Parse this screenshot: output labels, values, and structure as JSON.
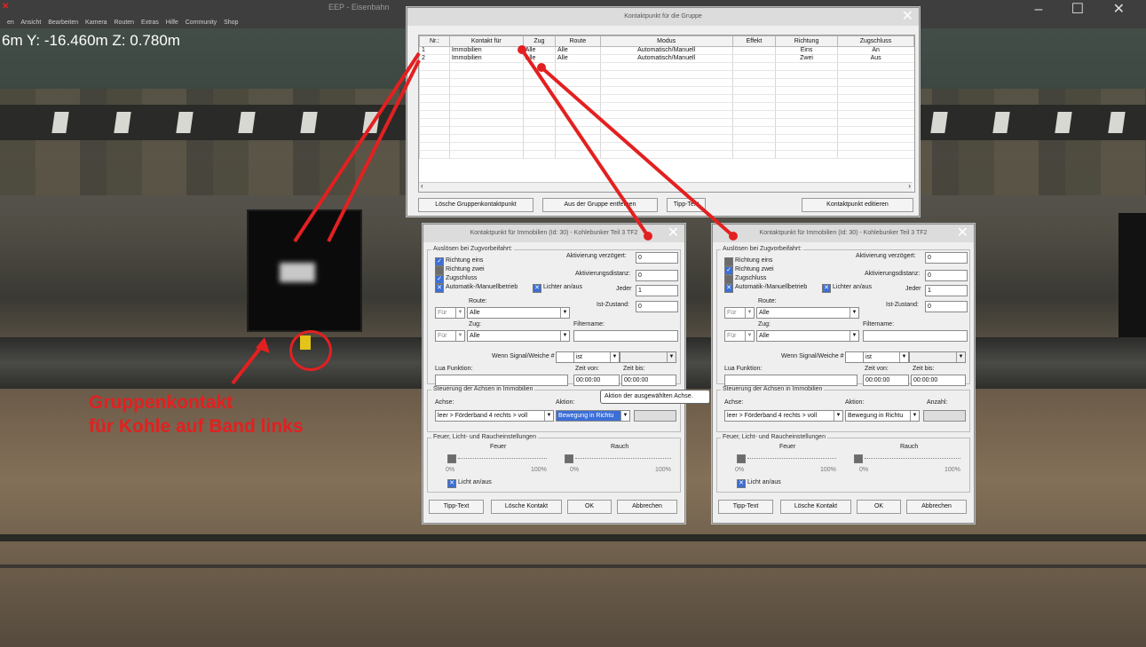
{
  "app": {
    "title": "EEP - Eisenbahn",
    "menu": "en Ansicht Bearbeiten Kamera Routen Extras Hilfe Community Shop",
    "coords": "6m Y: -16.460m Z: 0.780m",
    "window_controls": "– ☐ ✕"
  },
  "annotation": {
    "line1": "Gruppenkontakt",
    "line2": "für Kohle auf Band links"
  },
  "group_dialog": {
    "title": "Kontaktpunkt für die Gruppe",
    "columns": [
      "Nr.:",
      "Kontakt für",
      "Zug",
      "Route",
      "Modus",
      "Effekt",
      "Richtung",
      "Zugschluss"
    ],
    "rows": [
      [
        "1",
        "Immobilien",
        "Alle",
        "Alle",
        "Automatisch/Manuell",
        "",
        "Eins",
        "An"
      ],
      [
        "2",
        "Immobilien",
        "Alle",
        "Alle",
        "Automatisch/Manuell",
        "",
        "Zwei",
        "Aus"
      ]
    ],
    "buttons": {
      "delete_group": "Lösche Gruppenkontaktpunkt",
      "remove": "Aus der Gruppe entfernen",
      "tip": "Tipp-Text",
      "edit": "Kontaktpunkt editieren"
    }
  },
  "contact_dialog_left": {
    "title": "Kontaktpunkt für Immobilien (Id: 30) - Kohlebunker Teil 3 TF2",
    "trigger_group": "Auslösen bei Zugvorbeifahrt:",
    "cb1": "Richtung eins",
    "cb2": "Richtung zwei",
    "cb3": "Zugschluss",
    "cb4": "Automatik-/Manuellbetrieb",
    "cb5": "Lichter an/aus",
    "delay_label": "Aktivierung verzögert:",
    "delay": "0",
    "dist_label": "Aktivierungsdistanz:",
    "dist": "0",
    "every_label": "Jeder",
    "every": "1",
    "state_label": "Ist-Zustand:",
    "state": "0",
    "route_label": "Route:",
    "route_mode": "Für",
    "route": "Alle",
    "train_label": "Zug:",
    "train_mode": "Für",
    "train": "Alle",
    "filter_label": "Filtername:",
    "signal_label": "Wenn Signal/Weiche #",
    "signal_op": "ist",
    "lua_label": "Lua Funktion:",
    "from_label": "Zeit von:",
    "from": "00:00:00",
    "to_label": "Zeit bis:",
    "to": "00:00:00",
    "axes_group": "Steuerung der Achsen in Immobilien",
    "axis_label": "Achse:",
    "axis": "leer > Förderband 4 rechts > voll",
    "action_label": "Aktion:",
    "action": "Bewegung in Richtu",
    "count_label": "Anzahl:",
    "fire_group": "Feuer, Licht- und Raucheinstellungen",
    "fire_label": "Feuer",
    "smoke_label": "Rauch",
    "p0": "0%",
    "p100": "100%",
    "light_label": "Licht an/aus",
    "btn_tip": "Tipp-Text",
    "btn_delete": "Lösche Kontakt",
    "btn_ok": "OK",
    "btn_cancel": "Abbrechen",
    "tooltip": "Aktion der ausgewählten Achse."
  },
  "contact_dialog_right": {
    "title": "Kontaktpunkt für Immobilien (Id: 30) - Kohlebunker Teil 3 TF2",
    "axis": "leer > Förderband 4 rechts > voll",
    "action": "Bewegung in Richtu"
  }
}
